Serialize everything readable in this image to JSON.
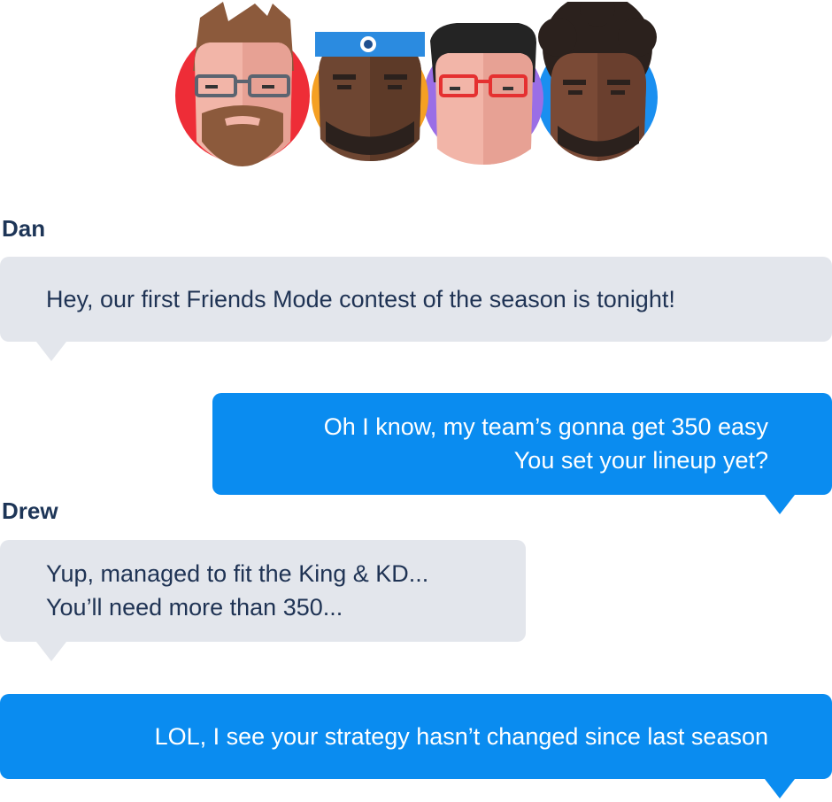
{
  "participants": [
    {
      "id": "p1",
      "bg": "#ee2d37",
      "icon": "avatar-bearded-glasses"
    },
    {
      "id": "p2",
      "bg": "#f5a023",
      "icon": "avatar-headband"
    },
    {
      "id": "p3",
      "bg": "#9a6ee6",
      "icon": "avatar-red-glasses"
    },
    {
      "id": "p4",
      "bg": "#1a8ff0",
      "icon": "avatar-afro"
    }
  ],
  "chat": {
    "sender_dan": "Dan",
    "msg1": "Hey, our first Friends Mode contest of the season is tonight!",
    "msg2_line1": "Oh I know, my team’s gonna get 350 easy",
    "msg2_line2": "You set your lineup yet?",
    "sender_drew": "Drew",
    "msg3_line1": "Yup, managed to fit the King & KD...",
    "msg3_line2": "You’ll need more than 350...",
    "msg4": "LOL, I see your strategy hasn’t changed since last season"
  },
  "colors": {
    "incoming_bubble": "#e3e6ec",
    "outgoing_bubble": "#0a8cf0",
    "incoming_text": "#1f3354",
    "name_text": "#1d3557"
  }
}
